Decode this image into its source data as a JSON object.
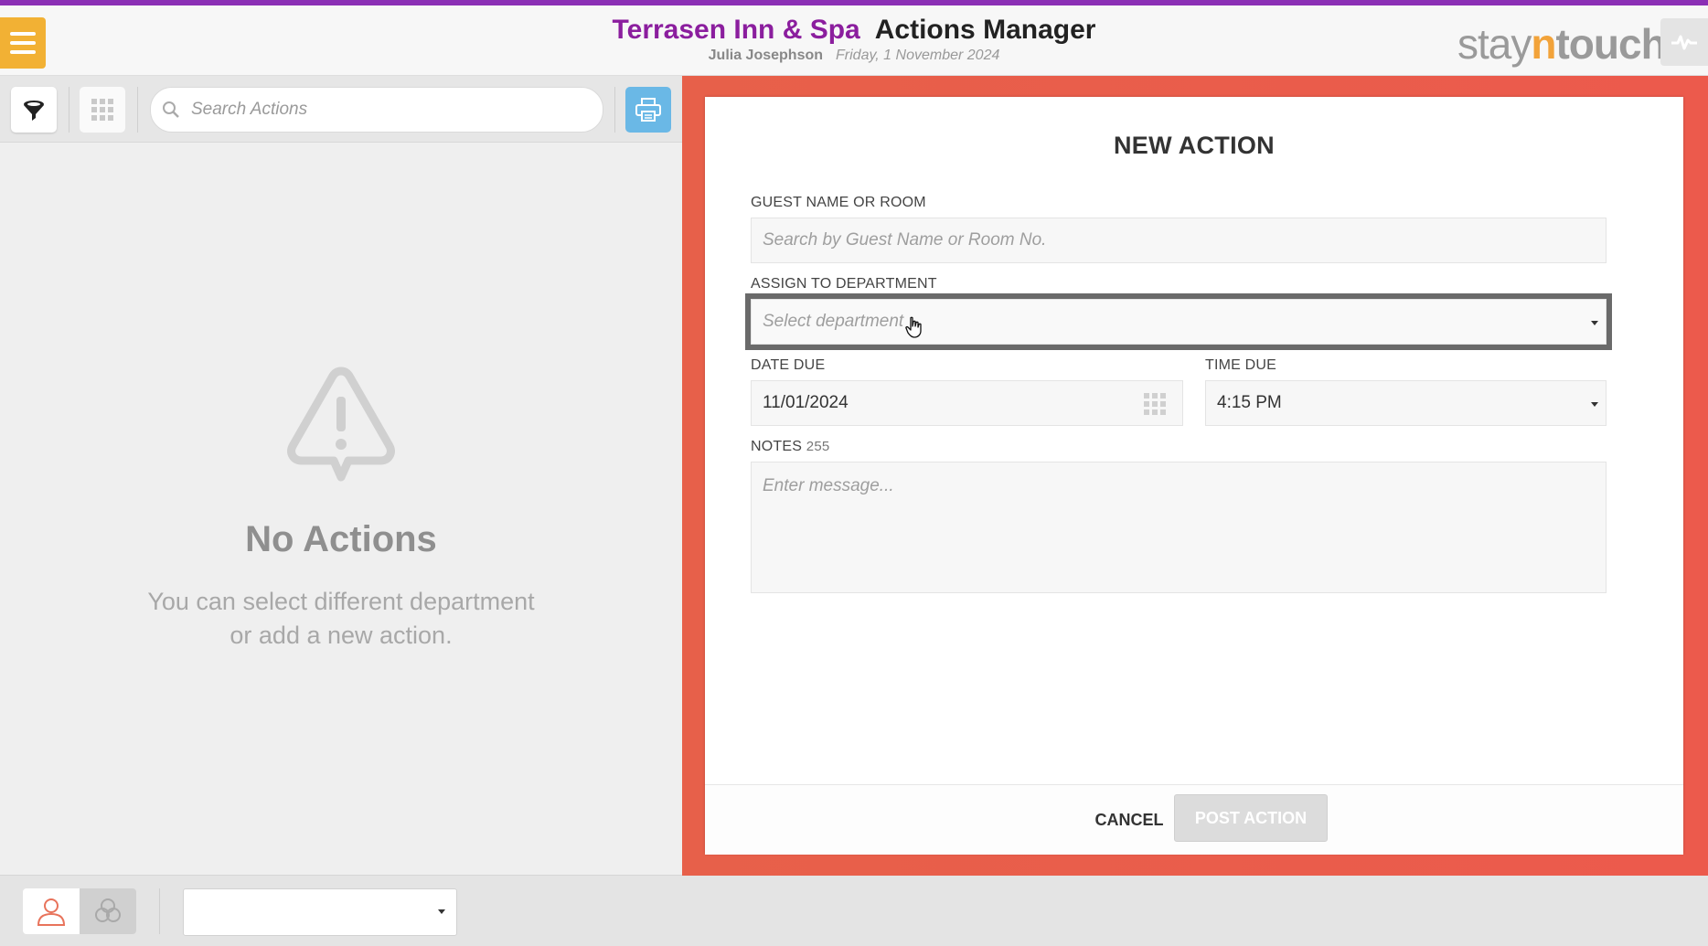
{
  "header": {
    "hotel_name": "Terrasen Inn & Spa",
    "module_name": "Actions Manager",
    "user_name": "Julia Josephson",
    "date": "Friday, 1 November 2024",
    "brand_stay": "stay",
    "brand_n": "n",
    "brand_touch": "touch"
  },
  "left": {
    "search_placeholder": "Search Actions",
    "empty_title": "No Actions",
    "empty_message_line1": "You can select different department",
    "empty_message_line2": "or add a new action."
  },
  "bottom": {
    "department_value": ""
  },
  "modal": {
    "title": "NEW ACTION",
    "guest_label": "GUEST NAME OR ROOM",
    "guest_placeholder": "Search by Guest Name or Room No.",
    "dept_label": "ASSIGN TO DEPARTMENT",
    "dept_placeholder": "Select department",
    "date_label": "DATE DUE",
    "date_value": "11/01/2024",
    "time_label": "TIME DUE",
    "time_value": "4:15 PM",
    "notes_label": "NOTES",
    "notes_count": "255",
    "notes_placeholder": "Enter message...",
    "cancel_label": "CANCEL",
    "post_label": "POST ACTION"
  },
  "colors": {
    "brand_purple": "#8b1e9e",
    "menu_orange": "#f2b134",
    "modal_backdrop": "#e7604a",
    "print_blue": "#6ab8e6"
  },
  "icons": [
    "menu-icon",
    "pulse-icon",
    "filter-icon",
    "grid-icon",
    "search-icon",
    "print-icon",
    "warning-icon",
    "user-icon",
    "team-icon",
    "calendar-icon",
    "chevron-down-icon",
    "hand-cursor-icon"
  ]
}
